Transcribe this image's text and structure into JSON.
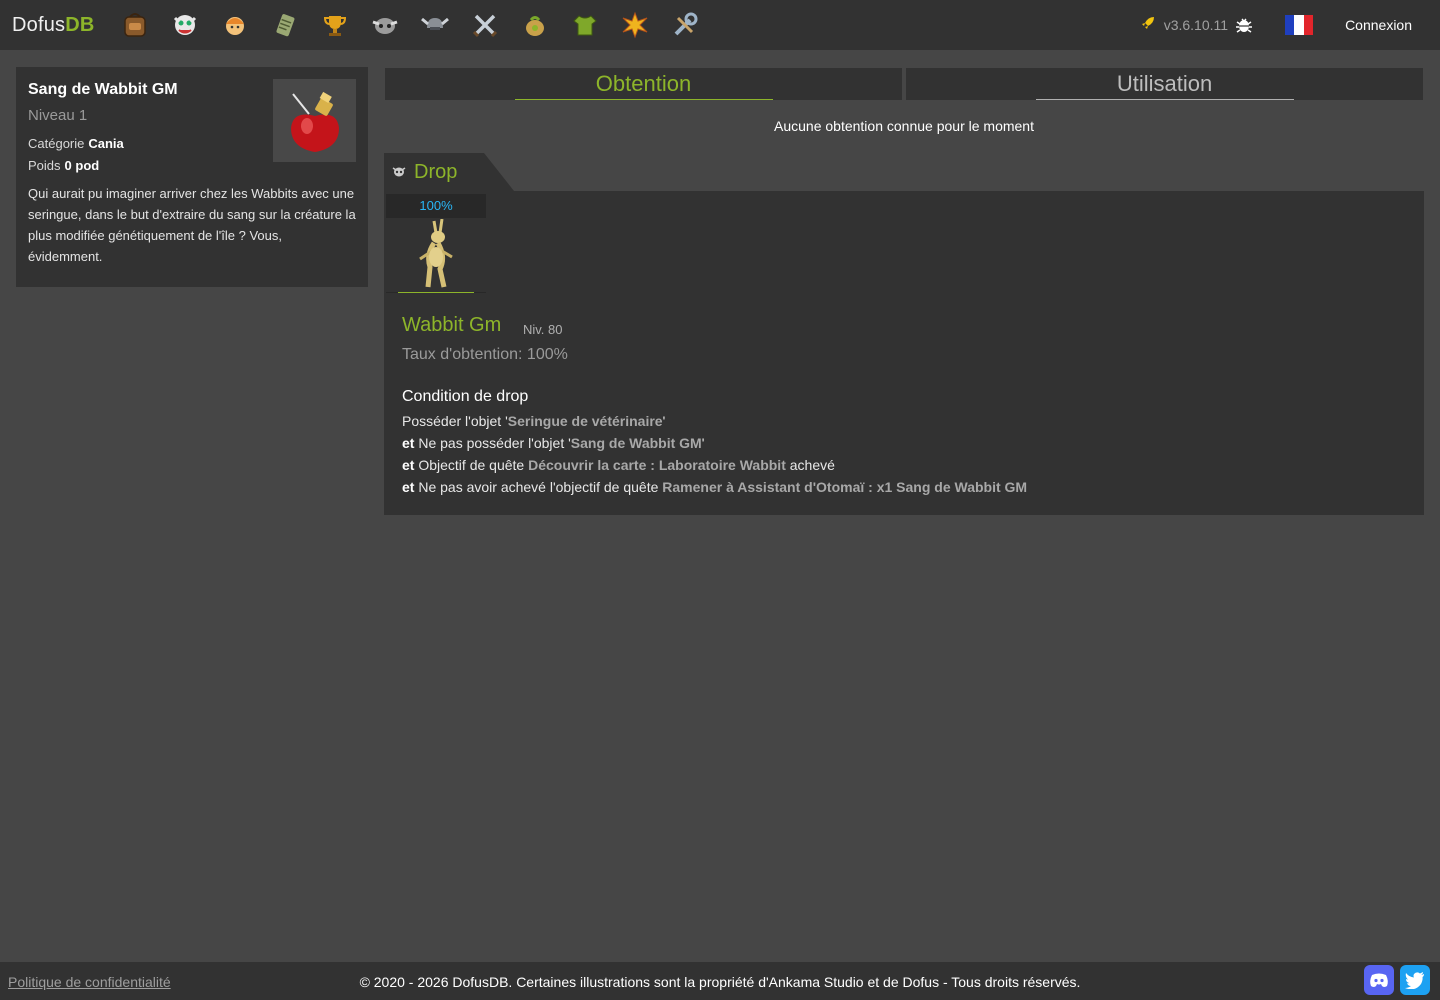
{
  "header": {
    "logo_prefix": "Dofus",
    "logo_suffix": "DB",
    "nav_icons": [
      "backpack-icon",
      "monster-icon",
      "character-icon",
      "scroll-icon",
      "trophy-icon",
      "boss-icon",
      "helmet-icon",
      "swords-icon",
      "bag-icon",
      "shirt-icon",
      "explosion-icon",
      "tools-icon"
    ],
    "version": "v3.6.10.11",
    "login": "Connexion"
  },
  "item": {
    "name": "Sang de Wabbit GM",
    "level": "Niveau 1",
    "category_label": "Catégorie",
    "category_value": "Cania",
    "weight_label": "Poids",
    "weight_value": "0 pod",
    "description": "Qui aurait pu imaginer arriver chez les Wabbits avec une seringue, dans le but d'extraire du sang sur la créature la plus modifiée génétiquement de l'île ? Vous, évidemment."
  },
  "tabs": {
    "obtention": "Obtention",
    "utilisation": "Utilisation"
  },
  "notice": "Aucune obtention connue pour le moment",
  "drop": {
    "title": "Drop",
    "rate_badge": "100%",
    "monster_name": "Wabbit Gm",
    "monster_level": "Niv. 80",
    "drop_rate": "Taux d'obtention: 100%",
    "condition_title": "Condition de drop",
    "conditions": [
      {
        "prefix": "",
        "text_before": "Posséder l'objet '",
        "highlight": "Seringue de vétérinaire",
        "text_after": "'"
      },
      {
        "prefix": "et",
        "text_before": " Ne pas posséder l'objet '",
        "highlight": "Sang de Wabbit GM",
        "text_after": "'"
      },
      {
        "prefix": "et",
        "text_before": " Objectif de quête ",
        "highlight": "Découvrir la carte : Laboratoire Wabbit",
        "text_after": " achevé"
      },
      {
        "prefix": "et",
        "text_before": " Ne pas avoir achevé l'objectif de quête ",
        "highlight": "Ramener à Assistant d'Otomaï : x1 Sang de Wabbit GM",
        "text_after": ""
      }
    ]
  },
  "footer": {
    "privacy": "Politique de confidentialité",
    "copyright": "© 2020 - 2026 DofusDB. Certaines illustrations sont la propriété d'Ankama Studio et de Dofus - Tous droits réservés."
  },
  "colors": {
    "accent": "#8db52a",
    "rate": "#29b6f6",
    "discord": "#5865f2",
    "twitter": "#1da1f2"
  }
}
